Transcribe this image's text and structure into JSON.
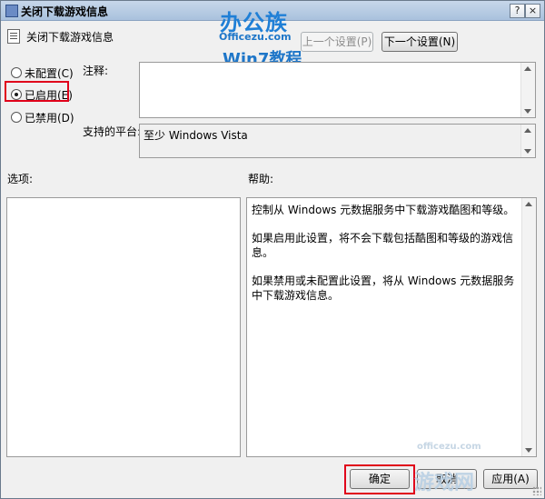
{
  "window": {
    "title": "关闭下载游戏信息",
    "controls": {
      "help": "?",
      "close": "×"
    }
  },
  "header": {
    "policy_name": "关闭下载游戏信息",
    "prev_button": "上一个设置(P)",
    "next_button": "下一个设置(N)"
  },
  "watermark": {
    "brand": "办公族",
    "site": "Officezu.com",
    "subtitle": "Win7教程",
    "bottom_brand": "游戏网",
    "bottom_site": "officezu.com"
  },
  "options": {
    "not_configured": "未配置(C)",
    "enabled": "已启用(E)",
    "disabled": "已禁用(D)",
    "selected": "enabled"
  },
  "comment": {
    "label": "注释:",
    "value": ""
  },
  "supported_on": {
    "label": "支持的平台:",
    "value": "至少 Windows Vista"
  },
  "sections": {
    "options_label": "选项:",
    "help_label": "帮助:"
  },
  "help": {
    "paragraphs": [
      "控制从 Windows 元数据服务中下载游戏酷图和等级。",
      "如果启用此设置，将不会下载包括酷图和等级的游戏信息。",
      "如果禁用或未配置此设置，将从 Windows 元数据服务中下载游戏信息。"
    ]
  },
  "footer": {
    "ok_button": "确定",
    "cancel_button": "取消",
    "apply_button": "应用(A)"
  },
  "colors": {
    "highlight": "#e0001a",
    "watermark": "#1f7fd6"
  }
}
